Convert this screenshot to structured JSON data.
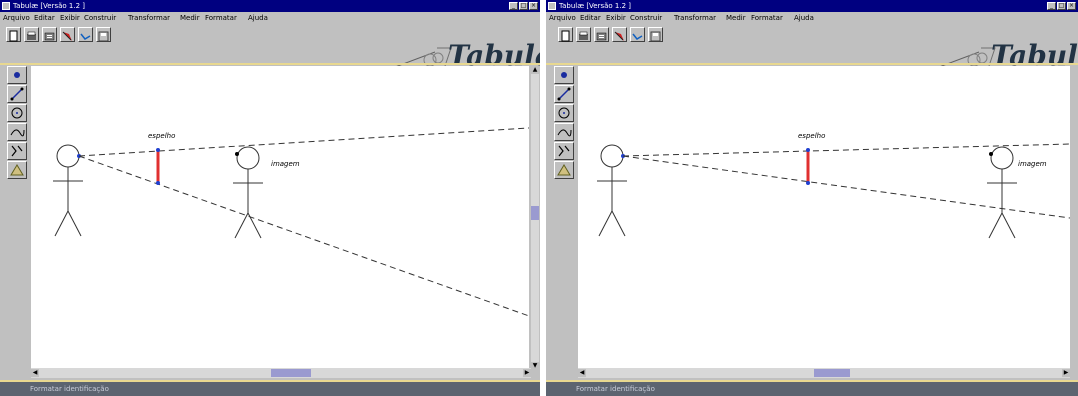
{
  "windows": [
    {
      "title": "Tabulæ [Versão 1.2 ]",
      "menu": [
        "Arquivo",
        "Editar",
        "Exibir",
        "Construir",
        "Transformar",
        "Medir",
        "Formatar",
        "Ajuda"
      ],
      "logo": "Tabulæ",
      "canvas": {
        "mirror_label": "espelho",
        "image_label": "imagem"
      },
      "status": "Formatar identificação"
    },
    {
      "title": "Tabulæ [Versão 1.2 ]",
      "menu": [
        "Arquivo",
        "Editar",
        "Exibir",
        "Construir",
        "Transformar",
        "Medir",
        "Formatar",
        "Ajuda"
      ],
      "logo": "Tabulæ",
      "canvas": {
        "mirror_label": "espelho",
        "image_label": "imagem"
      },
      "status": "Formatar identificação"
    }
  ],
  "colors": {
    "titlebar": "#000080",
    "mirror": "#e03030",
    "point": "#2040d0",
    "status_bg": "#5c6470",
    "accent_line": "#e8d890"
  },
  "icons": {
    "toolbar": [
      "new-document-icon",
      "open-icon",
      "print-icon",
      "red-arrow-icon",
      "curve-tool-icon",
      "save-icon"
    ],
    "left_tools": [
      "point-tool-icon",
      "line-tool-icon",
      "circle-tool-icon",
      "curve-tool-icon",
      "transform-tool-icon",
      "measure-tool-icon"
    ]
  }
}
